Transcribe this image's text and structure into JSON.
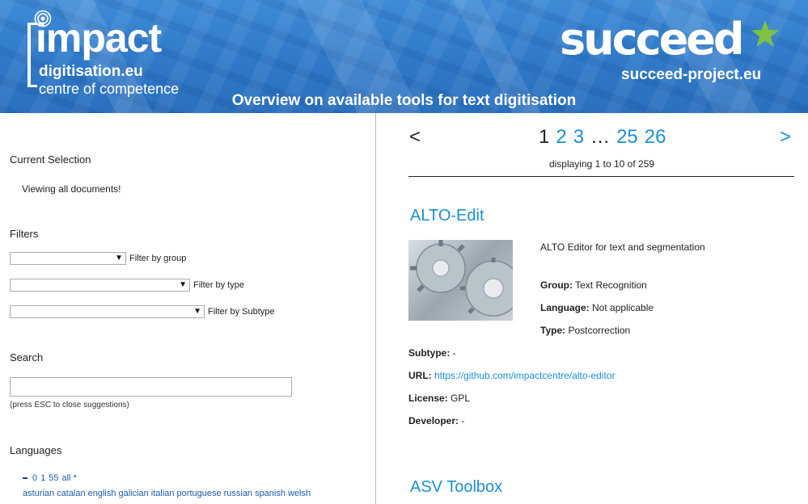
{
  "header": {
    "impact_word": "impact",
    "impact_line1": "digitisation.eu",
    "impact_line2": "centre of competence",
    "succeed_word": "succeed",
    "succeed_site": "succeed-project.eu",
    "title": "Overview on available tools for text digitisation",
    "star_color": "#7dc242"
  },
  "sidebar": {
    "current_selection_heading": "Current Selection",
    "current_selection_text": "Viewing all documents!",
    "filters_heading": "Filters",
    "filter_group_label": "Filter by group",
    "filter_type_label": "Filter by type",
    "filter_subtype_label": "Filter by Subtype",
    "search_heading": "Search",
    "search_hint": "(press ESC to close suggestions)",
    "languages_heading": "Languages",
    "language_ranges": [
      "0",
      "1",
      "55",
      "all *"
    ],
    "languages": [
      "asturian",
      "catalan",
      "english",
      "galician",
      "italian",
      "portuguese",
      "russian",
      "spanish",
      "welsh"
    ]
  },
  "pagination": {
    "prev": "<",
    "next": ">",
    "current": "1",
    "pages": [
      "2",
      "3"
    ],
    "ellipsis": "…",
    "last_pages": [
      "25",
      "26"
    ],
    "displaying": "displaying 1 to 10 of 259"
  },
  "tools": [
    {
      "title": "ALTO-Edit",
      "description": "ALTO Editor for text and segmentation",
      "group_label": "Group:",
      "group": "Text Recognition",
      "language_label": "Language:",
      "language": "Not applicable",
      "type_label": "Type:",
      "type": "Postcorrection",
      "subtype_label": "Subtype:",
      "subtype": "-",
      "url_label": "URL:",
      "url": "https://github.com/impactcentre/alto-editor",
      "license_label": "License:",
      "license": "GPL",
      "developer_label": "Developer:",
      "developer": "-"
    },
    {
      "title": "ASV Toolbox"
    }
  ],
  "colors": {
    "link": "#1a8fd0",
    "banner": "#2f79c8"
  }
}
